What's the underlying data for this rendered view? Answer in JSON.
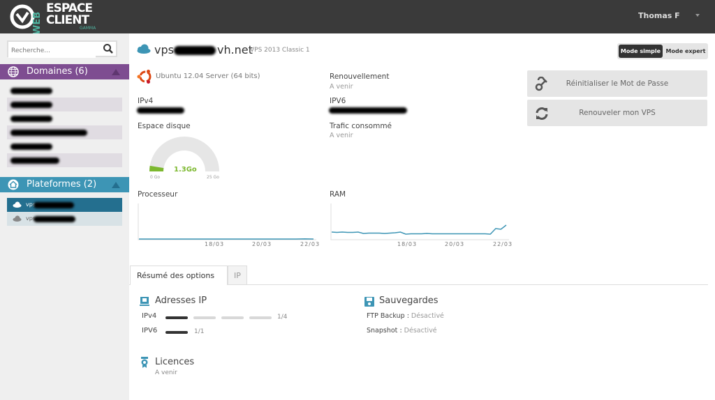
{
  "header": {
    "logo_text": {
      "web": "WEB",
      "line1": "ESPACE",
      "line2": "CLIENT",
      "sub": "GAMMA"
    },
    "user": "Thomas F"
  },
  "sidebar": {
    "search_placeholder": "Recherche...",
    "domains": {
      "title": "Domaines (6)",
      "color": "#7e4d91",
      "count_rows": 6
    },
    "platforms": {
      "title": "Plateformes (2)",
      "color": "#3d95b5",
      "items": [
        {
          "prefix": "vps",
          "active": true
        },
        {
          "prefix": "vps",
          "active": false
        }
      ]
    }
  },
  "main": {
    "title_prefix": "vps",
    "title_suffix": "vh.net",
    "plan": "VPS 2013 Classic 1",
    "mode": {
      "simple": "Mode simple",
      "expert": "Mode expert",
      "selected": "simple"
    },
    "os": "Ubuntu 12.04 Server (64 bits)",
    "ipv4_label": "IPv4",
    "ipv6_label": "IPV6",
    "renewal_label": "Renouvellement",
    "renewal_value": "A venir",
    "traffic_label": "Trafic consommé",
    "traffic_value": "A venir",
    "disk": {
      "label": "Espace disque",
      "value": "1.3Go",
      "min": "0 Go",
      "max": "25 Go",
      "used": 1.3,
      "total": 25
    },
    "actions": [
      {
        "label": "Réinitialiser le Mot de Passe",
        "icon": "key-icon"
      },
      {
        "label": "Renouveler mon VPS",
        "icon": "refresh-icon"
      }
    ],
    "accent": "#3d95b5"
  },
  "chart_data": [
    {
      "type": "line",
      "title": "Processeur",
      "x_ticks": [
        "18/03",
        "20/03",
        "22/03"
      ],
      "values": [
        0,
        0,
        0,
        0,
        0,
        0,
        0,
        0,
        0,
        0,
        0,
        0,
        0,
        0,
        0,
        0,
        0,
        0,
        0,
        0.5,
        0
      ]
    },
    {
      "type": "line",
      "title": "RAM",
      "x_ticks": [
        "18/03",
        "20/03",
        "22/03"
      ],
      "values": [
        20,
        19,
        20,
        19,
        19,
        20,
        16,
        17,
        17,
        17,
        16,
        17,
        18,
        20,
        14,
        15,
        15,
        15,
        16,
        15,
        15,
        15,
        15,
        15,
        15,
        15,
        15,
        15,
        15,
        15,
        14,
        30,
        28,
        40
      ]
    }
  ],
  "tabs": [
    {
      "label": "Résumé des options",
      "active": true
    },
    {
      "label": "IP",
      "active": false
    }
  ],
  "options": {
    "ip": {
      "title": "Adresses IP",
      "rows": [
        {
          "label": "IPv4",
          "used": 1,
          "total": 4,
          "text": "1/4"
        },
        {
          "label": "IPV6",
          "used": 1,
          "total": 1,
          "text": "1/1"
        }
      ]
    },
    "backups": {
      "title": "Sauvegardes",
      "rows": [
        {
          "label": "FTP Backup",
          "value": "Désactivé"
        },
        {
          "label": "Snapshot",
          "value": "Désactivé"
        }
      ]
    },
    "licences": {
      "title": "Licences",
      "value": "A venir"
    }
  }
}
